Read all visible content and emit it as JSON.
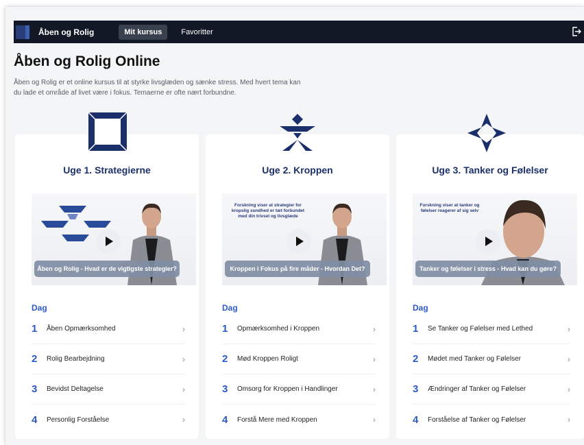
{
  "nav": {
    "brand": "Åben og Rolig",
    "tabs": [
      {
        "label": "Mit kursus",
        "active": true
      },
      {
        "label": "Favoritter",
        "active": false
      }
    ]
  },
  "page": {
    "title": "Åben og Rolig Online",
    "intro": "Åben og Rolig er et online kursus til at styrke livsglæden og sænke stress. Med hvert tema kan du lade et område af livet være i fokus. Temaerne er ofte nært forbundne."
  },
  "colors": {
    "navy": "#1b2f6b",
    "accent": "#2a59c7",
    "nav_bg": "#121826"
  },
  "day_label": "Dag",
  "weeks": [
    {
      "title": "Uge 1. Strategierne",
      "icon": "square-frame-icon",
      "video_caption": "Åben og Rolig - Hvad er de vigtigste strategier?",
      "lessons": [
        {
          "num": "1",
          "title": "Åben Opmærksomhed"
        },
        {
          "num": "2",
          "title": "Rolig Bearbejdning"
        },
        {
          "num": "3",
          "title": "Bevidst Deltagelse"
        },
        {
          "num": "4",
          "title": "Personlig Forståelse"
        }
      ]
    },
    {
      "title": "Uge 2. Kroppen",
      "icon": "figure-icon",
      "video_caption": "Kroppen i Fokus på fire måder - Hvordan Det?",
      "slide_text": "Forskning viser at strategier for kropslig sundhed er tæt forbundet med din trivsel og livsglæde",
      "lessons": [
        {
          "num": "1",
          "title": "Opmærksomhed i Kroppen"
        },
        {
          "num": "2",
          "title": "Mød Kroppen Roligt"
        },
        {
          "num": "3",
          "title": "Omsorg for Kroppen i Handlinger"
        },
        {
          "num": "4",
          "title": "Forstå Mere med Kroppen"
        }
      ]
    },
    {
      "title": "Uge 3. Tanker og Følelser",
      "icon": "four-point-star-icon",
      "video_caption": "Tanker og følelser i stress - Hvad kan du gøre?",
      "slide_text": "Forskning viser at tanker og følelser reagerer af sig selv",
      "lessons": [
        {
          "num": "1",
          "title": "Se Tanker og Følelser med Lethed"
        },
        {
          "num": "2",
          "title": "Mødet med Tanker og Følelser"
        },
        {
          "num": "3",
          "title": "Ændringer af Tanker og Følelser"
        },
        {
          "num": "4",
          "title": "Forståelse af Tanker og Følelser"
        }
      ]
    }
  ]
}
